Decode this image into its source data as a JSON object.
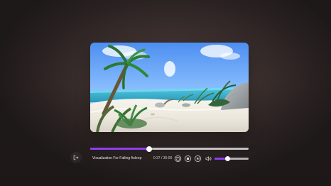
{
  "player": {
    "title": "Visualization For Falling Asleep",
    "time_display": "0:37 / 30:00",
    "progress_fraction": 0.37,
    "volume_fraction": 0.39
  },
  "controls": {
    "replay_icon": "rotate-ccw-icon",
    "stop_icon": "stop-circle-icon",
    "next_icon": "skip-next-circle-icon",
    "volume_icon": "volume-icon",
    "exit_icon": "exit-icon"
  },
  "colors": {
    "accent": "#8e3ef0",
    "text": "#e7e4e4"
  }
}
